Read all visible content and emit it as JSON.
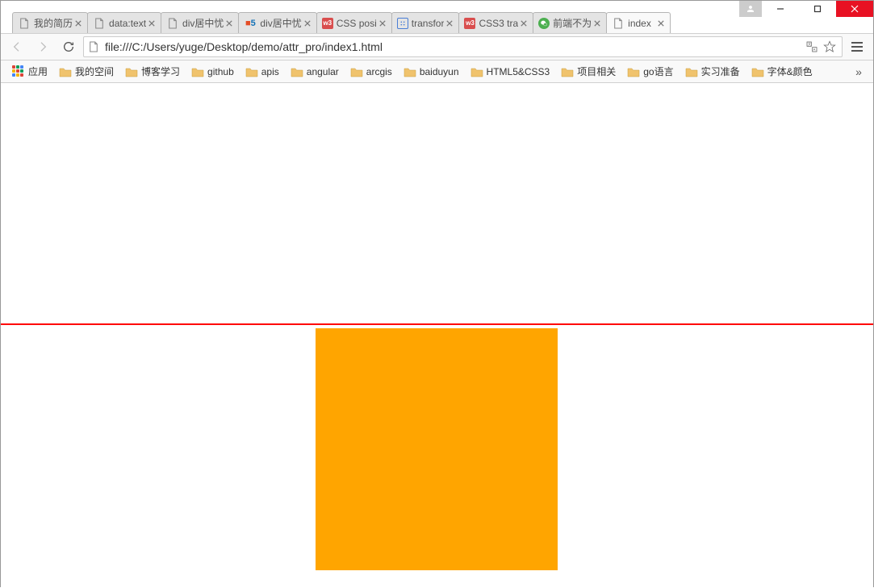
{
  "window": {
    "min_tip": "Minimize",
    "max_tip": "Maximize",
    "close_tip": "Close"
  },
  "tabs": [
    {
      "title": "我的简历",
      "icon": "doc"
    },
    {
      "title": "data:text",
      "icon": "doc"
    },
    {
      "title": "div居中忧",
      "icon": "doc"
    },
    {
      "title": "div居中忧",
      "icon": "h5"
    },
    {
      "title": "CSS posi",
      "icon": "w3"
    },
    {
      "title": "transfor",
      "icon": "baidu"
    },
    {
      "title": "CSS3 tra",
      "icon": "w3"
    },
    {
      "title": "前端不为",
      "icon": "wechat"
    },
    {
      "title": "index",
      "icon": "doc",
      "active": true
    }
  ],
  "omnibox": {
    "url": "file:///C:/Users/yuge/Desktop/demo/attr_pro/index1.html"
  },
  "bookmarks": {
    "apps_label": "应用",
    "items": [
      "我的空间",
      "博客学习",
      "github",
      "apis",
      "angular",
      "arcgis",
      "baiduyun",
      "HTML5&CSS3",
      "项目相关",
      "go语言",
      "实习准备",
      "字体&颜色"
    ],
    "overflow": "»"
  },
  "content": {
    "line_color": "#ff0000",
    "box_color": "#ffa500"
  }
}
